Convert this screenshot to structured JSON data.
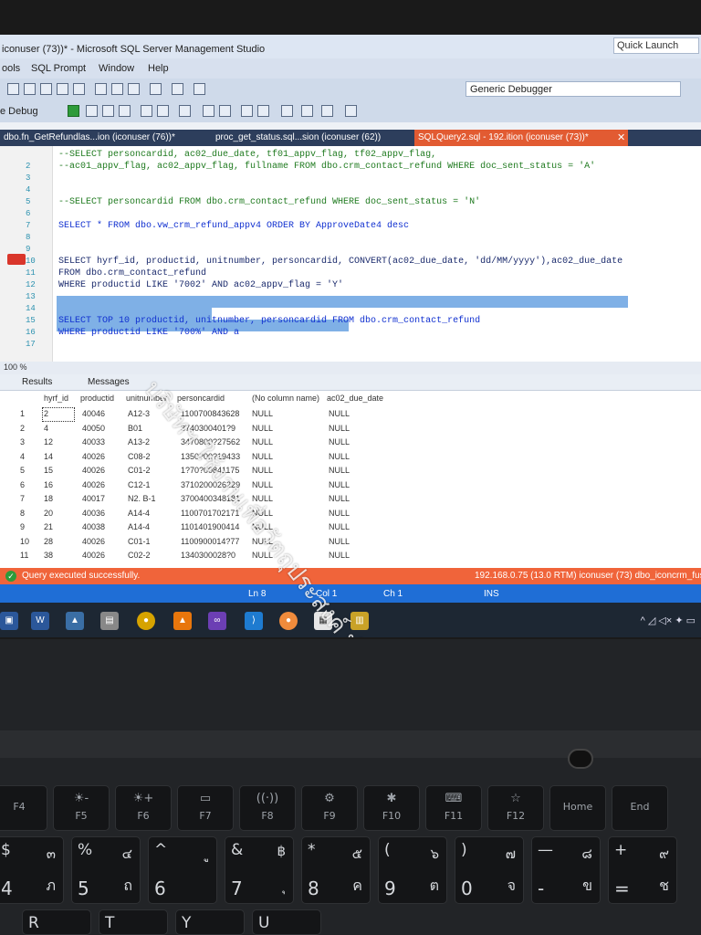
{
  "window": {
    "title": "iconuser (73))* - Microsoft SQL Server Management Studio",
    "quick_launch": "Quick Launch"
  },
  "menu": [
    "ools",
    "SQL Prompt",
    "Window",
    "Help"
  ],
  "toolbar": {
    "debugger": "Generic Debugger",
    "debug_label": "e Debug"
  },
  "tabs": [
    {
      "label": "dbo.fn_GetRefundlas...ion (iconuser (76))*",
      "active": false
    },
    {
      "label": "proc_get_status.sql...sion (iconuser (62))",
      "active": false
    },
    {
      "label": "SQLQuery2.sql - 192.ition (iconuser (73))*",
      "active": true
    }
  ],
  "editor": {
    "lines": [
      {
        "n": "",
        "text": "--SELECT personcardid, ac02_due_date, tf01_appv_flag, tf02_appv_flag,",
        "style": "comment"
      },
      {
        "n": "2",
        "text": "--ac01_appv_flag, ac02_appv_flag, fullname FROM dbo.crm_contact_refund WHERE doc_sent_status = 'A'",
        "style": "comment"
      },
      {
        "n": "3",
        "text": "",
        "style": "plain"
      },
      {
        "n": "4",
        "text": "",
        "style": "plain"
      },
      {
        "n": "5",
        "text": "--SELECT personcardid FROM dbo.crm_contact_refund WHERE doc_sent_status = 'N'",
        "style": "comment"
      },
      {
        "n": "6",
        "text": "",
        "style": "plain"
      },
      {
        "n": "7",
        "text": "SELECT * FROM dbo.vw_crm_refund_appv4 ORDER BY ApproveDate4 desc",
        "style": "kw"
      },
      {
        "n": "8",
        "text": "",
        "style": "plain"
      },
      {
        "n": "9",
        "text": "",
        "style": "plain"
      },
      {
        "n": "10",
        "text": "SELECT hyrf_id, productid, unitnumber, personcardid, CONVERT(ac02_due_date, 'dd/MM/yyyy'),ac02_due_date",
        "style": "sel"
      },
      {
        "n": "11",
        "text": "FROM dbo.crm_contact_refund",
        "style": "sel"
      },
      {
        "n": "12",
        "text": "WHERE productid LIKE '7002' AND ac02_appv_flag = 'Y'",
        "style": "sel"
      },
      {
        "n": "13",
        "text": "",
        "style": "plain"
      },
      {
        "n": "14",
        "text": "",
        "style": "plain"
      },
      {
        "n": "15",
        "text": "SELECT TOP 10 productid, unitnumber, personcardid FROM dbo.crm_contact_refund",
        "style": "kw"
      },
      {
        "n": "16",
        "text": "WHERE productid LIKE '700%' AND a",
        "style": "kw"
      },
      {
        "n": "17",
        "text": "",
        "style": "plain"
      }
    ],
    "zoom": "100 %"
  },
  "results": {
    "tab_results": "Results",
    "tab_messages": "Messages",
    "columns": [
      "hyrf_id",
      "productid",
      "unitnumber",
      "personcardid",
      "(No column name)",
      "ac02_due_date"
    ],
    "rows": [
      [
        "1",
        "2",
        "40046",
        "A12-3",
        "1100700843628",
        "NULL",
        "NULL"
      ],
      [
        "2",
        "4",
        "40050",
        "B01",
        "3740300401?9",
        "NULL",
        "NULL"
      ],
      [
        "3",
        "12",
        "40033",
        "A13-2",
        "3470800?27562",
        "NULL",
        "NULL"
      ],
      [
        "4",
        "14",
        "40026",
        "C08-2",
        "1350?00?19433",
        "NULL",
        "NULL"
      ],
      [
        "5",
        "15",
        "40026",
        "C01-2",
        "1?70?00841175",
        "NULL",
        "NULL"
      ],
      [
        "6",
        "16",
        "40026",
        "C12-1",
        "3710200026229",
        "NULL",
        "NULL"
      ],
      [
        "7",
        "18",
        "40017",
        "N2. B-1",
        "3700400348181",
        "NULL",
        "NULL"
      ],
      [
        "8",
        "20",
        "40036",
        "A14-4",
        "1100701702171",
        "NULL",
        "NULL"
      ],
      [
        "9",
        "21",
        "40038",
        "A14-4",
        "1101401900414",
        "NULL",
        "NULL"
      ],
      [
        "10",
        "28",
        "40026",
        "C01-1",
        "1100900014?77",
        "NULL",
        "NULL"
      ],
      [
        "11",
        "38",
        "40026",
        "C02-2",
        "1340300028?0",
        "NULL",
        "NULL"
      ]
    ]
  },
  "status": {
    "message": "Query executed successfully.",
    "server": "192.168.0.75 (13.0 RTM)  iconuser (73)  dbo_iconcrm_fusi",
    "ln": "Ln 8",
    "col": "Col 1",
    "ch": "Ch 1",
    "ins": "INS"
  },
  "watermark": "บริษัทฯ ใช้งานเพื่อวัตถุประสงค์ ทำเท่านั้น",
  "keyboard": {
    "fn_row": [
      {
        "label": "F4"
      },
      {
        "label": "F5",
        "icon": "☀-"
      },
      {
        "label": "F6",
        "icon": "☀+"
      },
      {
        "label": "F7",
        "icon": "▭"
      },
      {
        "label": "F8",
        "icon": "((·))"
      },
      {
        "label": "F9",
        "icon": "⚙"
      },
      {
        "label": "F10",
        "icon": "✱"
      },
      {
        "label": "F11",
        "icon": "⌨"
      },
      {
        "label": "F12",
        "icon": "☆"
      },
      {
        "label": "Home"
      },
      {
        "label": "End"
      }
    ],
    "num_row": [
      {
        "top": "$",
        "big": "4",
        "thai_t": "๓",
        "thai": "ภ"
      },
      {
        "top": "%",
        "big": "5",
        "thai_t": "๔",
        "thai": "ถ"
      },
      {
        "top": "^",
        "big": "6",
        "thai_t": "ู",
        "thai": ""
      },
      {
        "top": "&",
        "big": "7",
        "thai_t": "฿",
        "thai": "ุ"
      },
      {
        "top": "*",
        "big": "8",
        "thai_t": "๕",
        "thai": "ค"
      },
      {
        "top": "(",
        "big": "9",
        "thai_t": "๖",
        "thai": "ต"
      },
      {
        "top": ")",
        "big": "0",
        "thai_t": "๗",
        "thai": "จ"
      },
      {
        "top": "—",
        "big": "-",
        "thai_t": "๘",
        "thai": "ข"
      },
      {
        "top": "+",
        "big": "=",
        "thai_t": "๙",
        "thai": "ช"
      }
    ],
    "q_row": [
      "R",
      "T",
      "Y",
      "U"
    ]
  }
}
